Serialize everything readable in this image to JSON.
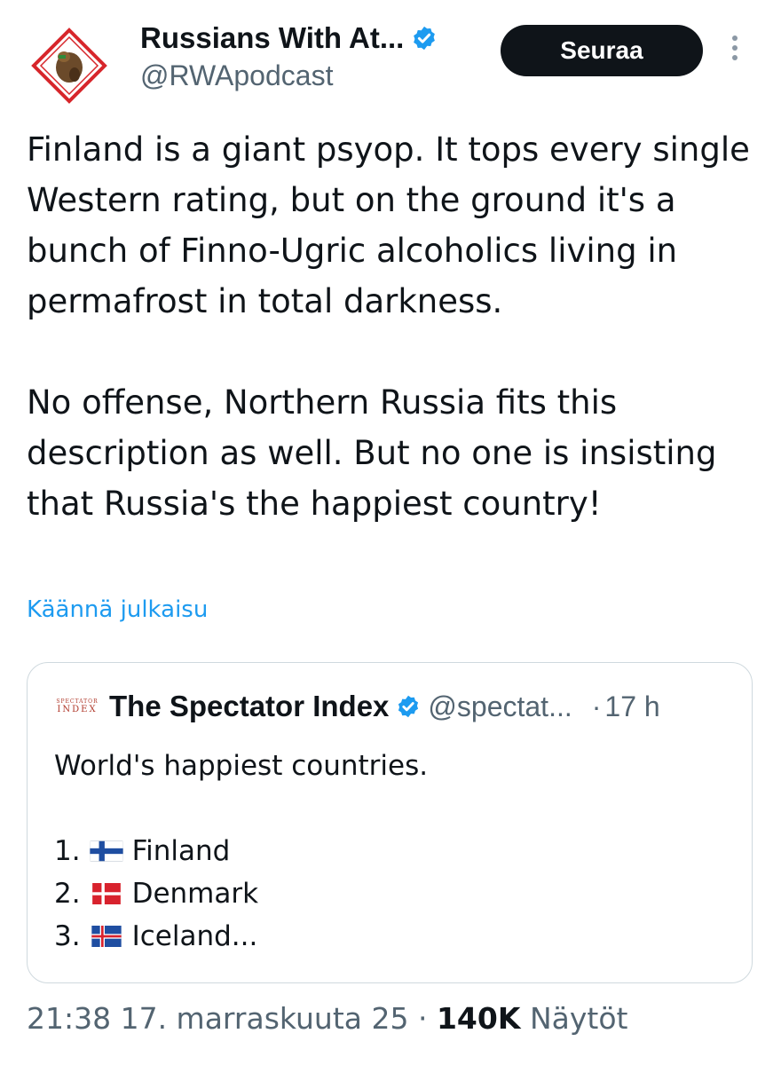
{
  "author": {
    "name": "Russians With At...",
    "handle": "@RWApodcast",
    "follow_label": "Seuraa"
  },
  "tweet": {
    "paragraph1": "Finland is a giant psyop. It tops every single Western rating, but on the ground it's a bunch of Finno-Ugric alcoholics living in permafrost in total darkness.",
    "paragraph2": "No offense, Northern Russia fits this description as well. But no one is insisting that Russia's the happiest country!",
    "translate_label": "Käännä julkaisu"
  },
  "quote": {
    "logo_top": "SPECTATOR",
    "logo_bottom": "INDEX",
    "name": "The Spectator Index",
    "handle": "@spectat...",
    "separator": "·",
    "time": "17 h",
    "text": "World's happiest countries.",
    "items": [
      {
        "num": "1.",
        "flag": "finland-flag-icon",
        "country": "Finland"
      },
      {
        "num": "2.",
        "flag": "denmark-flag-icon",
        "country": "Denmark"
      },
      {
        "num": "3.",
        "flag": "iceland-flag-icon",
        "country": "Iceland..."
      }
    ]
  },
  "footer": {
    "timestamp": "21:38 17. marraskuuta 25",
    "separator": "·",
    "views_count": "140K",
    "views_label": "Näytöt"
  },
  "colors": {
    "text": "#0f1419",
    "secondary": "#536471",
    "link": "#1d9bf0",
    "border": "#cfd9de",
    "verified": "#1d9bf0"
  }
}
